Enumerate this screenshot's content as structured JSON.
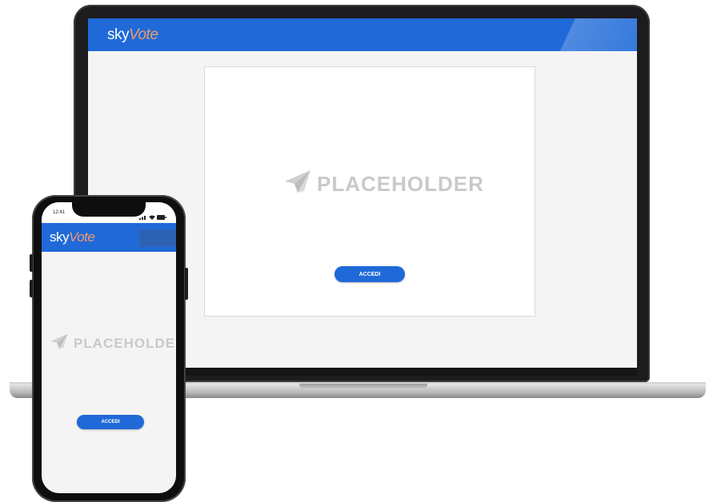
{
  "laptop": {
    "header": {
      "logo_part1": "sky",
      "logo_part2": "Vote"
    },
    "placeholder_text": "PLACEHOLDER",
    "login_button_label": "ACCEDI"
  },
  "phone": {
    "status_bar": {
      "time": "12:41"
    },
    "header": {
      "logo_part1": "sky",
      "logo_part2": "Vote"
    },
    "placeholder_text": "PLACEHOLDER",
    "login_button_label": "ACCEDI"
  },
  "colors": {
    "brand_blue": "#1f6ad8",
    "logo_accent": "#f29a6b",
    "placeholder_gray": "#c9c9c9"
  }
}
